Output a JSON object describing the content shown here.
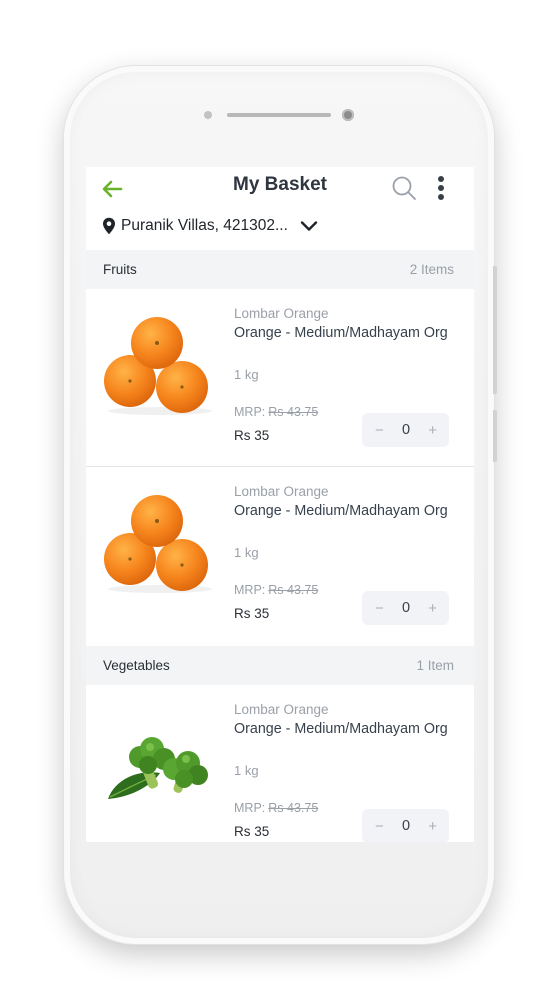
{
  "header": {
    "title": "My Basket",
    "back_icon": "arrow-left-icon",
    "search_icon": "search-icon",
    "menu_icon": "kebab-menu-icon",
    "accent_color": "#6bb22c"
  },
  "location": {
    "text": "Puranik Villas, 421302...",
    "pin_icon": "location-pin-icon",
    "chevron_icon": "chevron-down-icon"
  },
  "sections": [
    {
      "title": "Fruits",
      "count": "2 Items",
      "products": [
        {
          "brand": "Lombar Orange",
          "name": "Orange - Medium/Madhayam Org",
          "qty": "1 kg",
          "mrp_label": "MRP:",
          "mrp_value": "Rs 43.75",
          "price": "Rs 35",
          "count": "0",
          "image": "orange-fruit-image"
        },
        {
          "brand": "Lombar Orange",
          "name": "Orange - Medium/Madhayam Org",
          "qty": "1 kg",
          "mrp_label": "MRP:",
          "mrp_value": "Rs 43.75",
          "price": "Rs 35",
          "count": "0",
          "image": "orange-fruit-image"
        }
      ]
    },
    {
      "title": "Vegetables",
      "count": "1 Item",
      "products": [
        {
          "brand": "Lombar Orange",
          "name": "Orange - Medium/Madhayam Org",
          "qty": "1 kg",
          "mrp_label": "MRP:",
          "mrp_value": "Rs 43.75",
          "price": "Rs 35",
          "count": "0",
          "image": "broccoli-image"
        }
      ]
    }
  ],
  "stepper": {
    "minus_symbol": "−",
    "plus_symbol": "+"
  }
}
